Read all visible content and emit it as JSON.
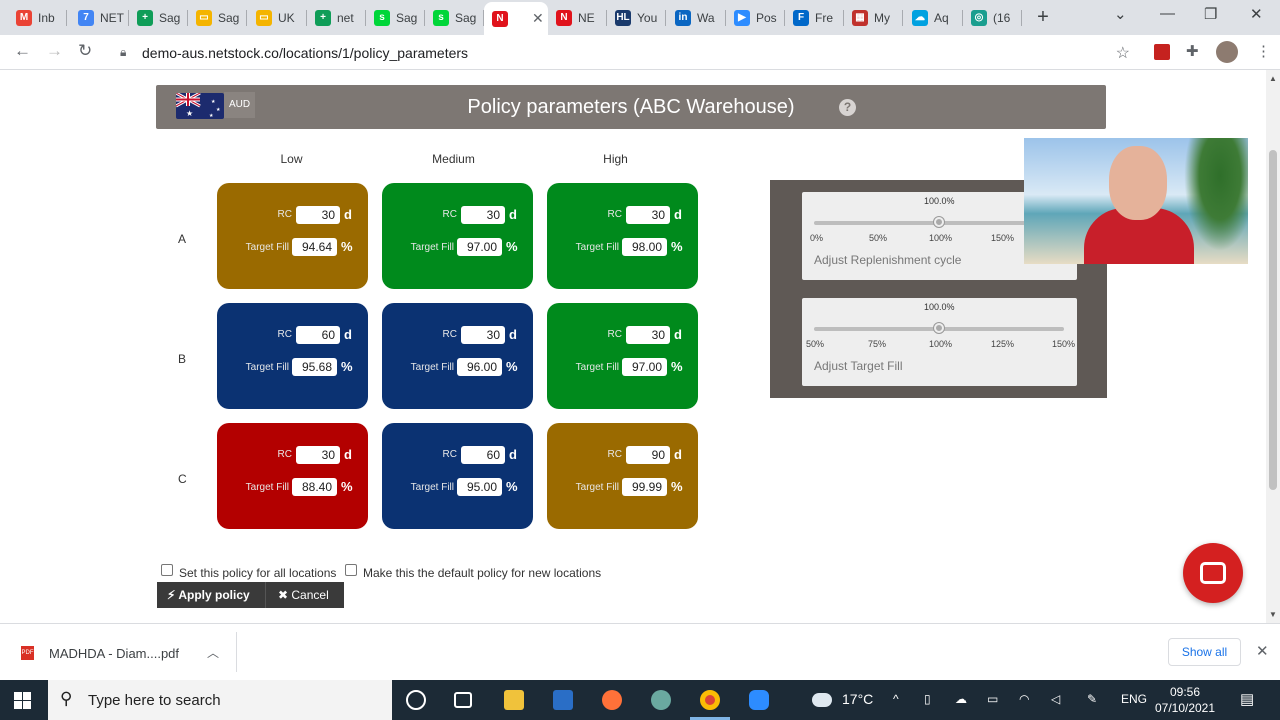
{
  "browser": {
    "tabs": [
      {
        "label": "Inb",
        "icon": "gmail-icon",
        "color": "#ea4335",
        "glyph": "M"
      },
      {
        "label": "NET",
        "icon": "calendar-icon",
        "color": "#4285f4",
        "glyph": "7"
      },
      {
        "label": "Sag",
        "icon": "sheets-icon",
        "color": "#0f9d58",
        "glyph": "+"
      },
      {
        "label": "Sag",
        "icon": "slides-icon",
        "color": "#f4b400",
        "glyph": "▭"
      },
      {
        "label": "UK",
        "icon": "slides-icon",
        "color": "#f4b400",
        "glyph": "▭"
      },
      {
        "label": "net",
        "icon": "sheets-icon",
        "color": "#0f9d58",
        "glyph": "+"
      },
      {
        "label": "Sag",
        "icon": "sage-icon",
        "color": "#00d639",
        "glyph": "s"
      },
      {
        "label": "Sag",
        "icon": "sage-icon",
        "color": "#00d639",
        "glyph": "s"
      },
      {
        "label": "",
        "icon": "netstock-icon",
        "color": "#e0131c",
        "glyph": "N",
        "active": true
      },
      {
        "label": "NE",
        "icon": "netstock-icon",
        "color": "#e0131c",
        "glyph": "N"
      },
      {
        "label": "You",
        "icon": "hl-icon",
        "color": "#1a3a6c",
        "glyph": "HL"
      },
      {
        "label": "Wa",
        "icon": "linkedin-icon",
        "color": "#0a66c2",
        "glyph": "in"
      },
      {
        "label": "Pos",
        "icon": "zoom-icon",
        "color": "#2d8cff",
        "glyph": "▶"
      },
      {
        "label": "Fre",
        "icon": "freshdesk-icon",
        "color": "#0068c9",
        "glyph": "F"
      },
      {
        "label": "My",
        "icon": "app-grid-icon",
        "color": "#c0312c",
        "glyph": "▦"
      },
      {
        "label": "Aq",
        "icon": "salesforce-icon",
        "color": "#00a1e0",
        "glyph": "☁"
      },
      {
        "label": "(16",
        "icon": "location-icon",
        "color": "#1a9e8f",
        "glyph": "◎"
      }
    ],
    "url": "demo-aus.netstock.co/locations/1/policy_parameters"
  },
  "header": {
    "title": "Policy parameters (ABC Warehouse)",
    "currency": "AUD",
    "help": "?"
  },
  "grid": {
    "columns": [
      "Low",
      "Medium",
      "High"
    ],
    "rows": [
      "A",
      "B",
      "C"
    ],
    "rc_label": "RC",
    "fill_label": "Target Fill",
    "rc_unit": "d",
    "fill_unit": "%",
    "cells": [
      {
        "rc": "30",
        "fill": "94.64",
        "color": "gold"
      },
      {
        "rc": "30",
        "fill": "97.00",
        "color": "green"
      },
      {
        "rc": "30",
        "fill": "98.00",
        "color": "green"
      },
      {
        "rc": "60",
        "fill": "95.68",
        "color": "navy"
      },
      {
        "rc": "30",
        "fill": "96.00",
        "color": "navy"
      },
      {
        "rc": "30",
        "fill": "97.00",
        "color": "green"
      },
      {
        "rc": "30",
        "fill": "88.40",
        "color": "red"
      },
      {
        "rc": "60",
        "fill": "95.00",
        "color": "navy"
      },
      {
        "rc": "90",
        "fill": "99.99",
        "color": "gold"
      }
    ]
  },
  "sliders": [
    {
      "name": "Adjust Replenishment cycle",
      "value": "100.0%",
      "value_fraction": 0.5,
      "ticks": [
        "0%",
        "50%",
        "100%",
        "150%"
      ]
    },
    {
      "name": "Adjust Target Fill",
      "value": "100.0%",
      "value_fraction": 0.5,
      "ticks": [
        "50%",
        "75%",
        "100%",
        "125%",
        "150%"
      ]
    }
  ],
  "options": {
    "all_locations": "Set this policy for all locations",
    "default_policy": "Make this the default policy for new locations"
  },
  "actions": {
    "apply": "Apply policy",
    "cancel": "Cancel"
  },
  "download": {
    "filename": "MADHDA - Diam....pdf",
    "show_all": "Show all"
  },
  "taskbar": {
    "search_placeholder": "Type here to search",
    "temperature": "17°C",
    "language": "ENG",
    "time": "09:56",
    "date": "07/10/2021"
  }
}
